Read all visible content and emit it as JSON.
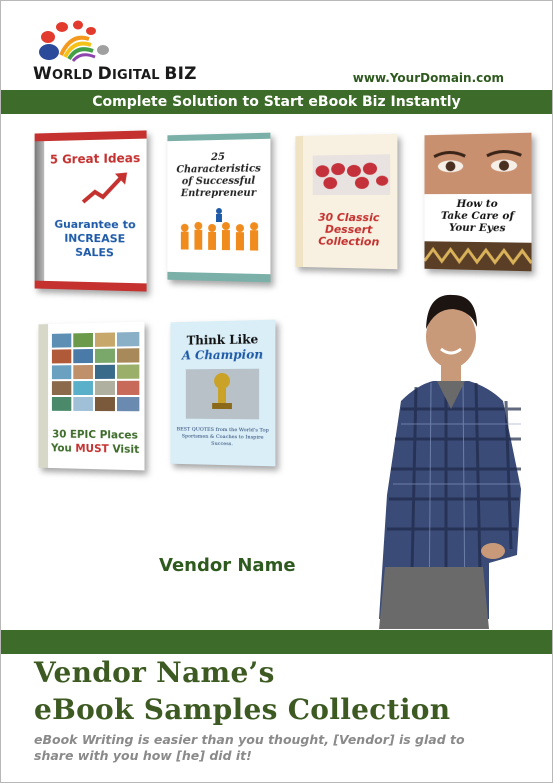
{
  "header": {
    "brand_first": "W",
    "brand_rest": "ORLD ",
    "brand_d": "D",
    "brand_igital": "IGITAL ",
    "brand_biz": "BIZ",
    "domain": "www.YourDomain.com"
  },
  "banner": "Complete Solution to Start eBook Biz Instantly",
  "books": [
    {
      "title_line1": "5 Great Ideas",
      "title_line2": "Guarantee to",
      "title_line3": "INCREASE",
      "title_line4": "SALES"
    },
    {
      "title_line1": "25",
      "title_line2": "Characteristics",
      "title_line3": "of Successful",
      "title_line4": "Entrepreneur"
    },
    {
      "title_line1": "30 Classic",
      "title_line2": "Dessert",
      "title_line3": "Collection"
    },
    {
      "title_line1": "How to",
      "title_line2": "Take Care of",
      "title_line3": "Your Eyes"
    },
    {
      "title_line1": "30 EPIC Places",
      "title_line2": "You",
      "title_emph": "MUST",
      "title_line3": "Visit"
    },
    {
      "title_line1": "Think Like",
      "title_line2": "A Champion",
      "footer": "BEST QUOTES from the World's Top Sportsmen & Coaches to Inspire Success."
    }
  ],
  "vendor_label": "Vendor Name",
  "title_line1": "Vendor Name’s",
  "title_line2": "eBook Samples Collection",
  "subtitle": "eBook Writing is easier than you thought, [Vendor] is glad to share with you how [he] did it!",
  "colors": {
    "green": "#3d6b2a",
    "title_green": "#3d5a22",
    "red": "#c4312f"
  }
}
